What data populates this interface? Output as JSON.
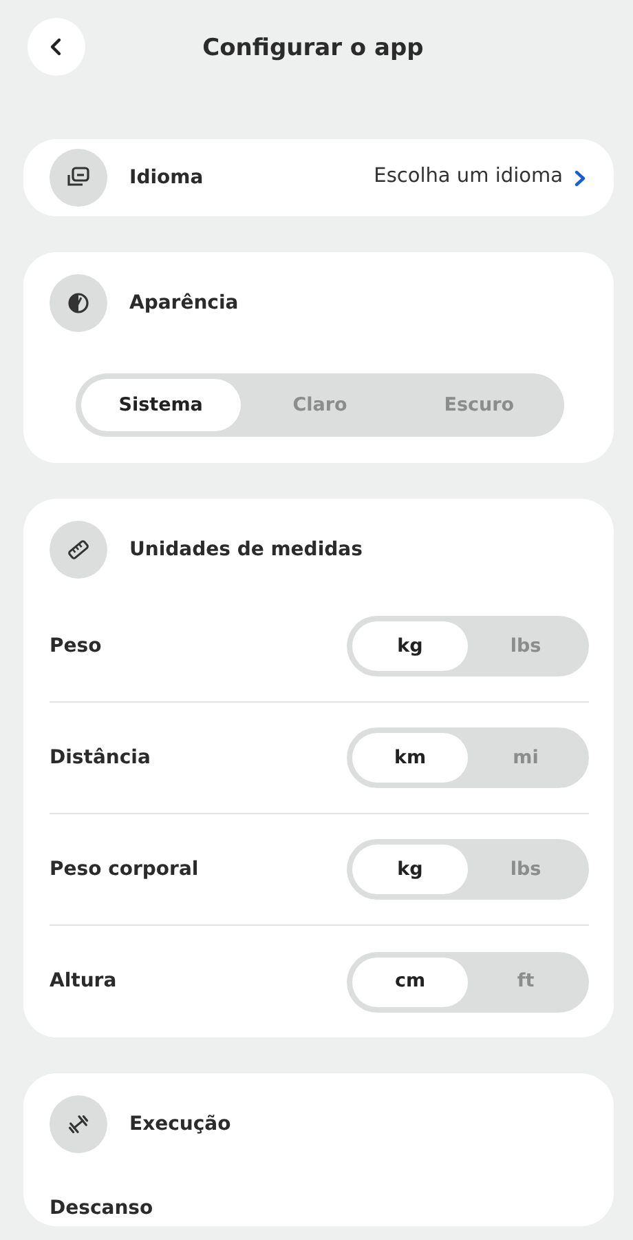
{
  "header": {
    "title": "Configurar o app"
  },
  "language": {
    "label": "Idioma",
    "value": "Escolha um idioma"
  },
  "appearance": {
    "title": "Aparência",
    "options": [
      {
        "label": "Sistema",
        "selected": true
      },
      {
        "label": "Claro",
        "selected": false
      },
      {
        "label": "Escuro",
        "selected": false
      }
    ]
  },
  "units": {
    "title": "Unidades de medidas",
    "rows": [
      {
        "label": "Peso",
        "options": [
          {
            "label": "kg",
            "selected": true
          },
          {
            "label": "lbs",
            "selected": false
          }
        ]
      },
      {
        "label": "Distância",
        "options": [
          {
            "label": "km",
            "selected": true
          },
          {
            "label": "mi",
            "selected": false
          }
        ]
      },
      {
        "label": "Peso corporal",
        "options": [
          {
            "label": "kg",
            "selected": true
          },
          {
            "label": "lbs",
            "selected": false
          }
        ]
      },
      {
        "label": "Altura",
        "options": [
          {
            "label": "cm",
            "selected": true
          },
          {
            "label": "ft",
            "selected": false
          }
        ]
      }
    ]
  },
  "execution": {
    "title": "Execução",
    "rows": [
      {
        "label": "Descanso"
      }
    ]
  }
}
